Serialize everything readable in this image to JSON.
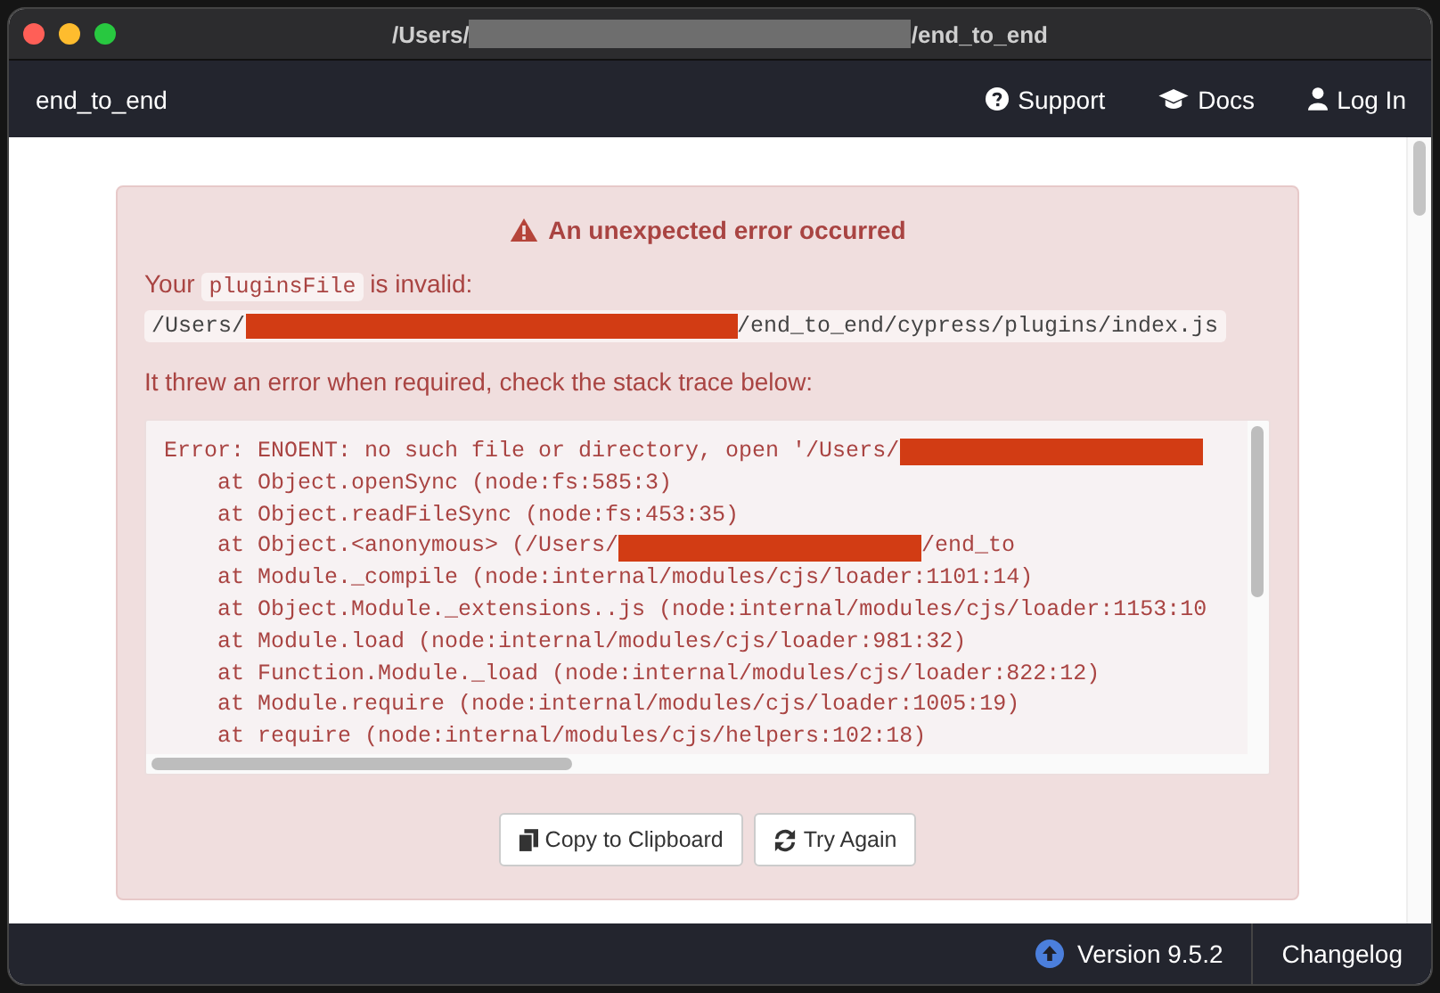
{
  "window": {
    "title_before": "/Users/",
    "title_after": "/end_to_end"
  },
  "navbar": {
    "project": "end_to_end",
    "links": [
      {
        "kind": "support",
        "label": "Support"
      },
      {
        "kind": "docs",
        "label": "Docs"
      },
      {
        "kind": "login",
        "label": "Log In"
      }
    ]
  },
  "error": {
    "heading": "An unexpected error occurred",
    "intro_before": "Your",
    "intro_code": "pluginsFile",
    "intro_after": "is invalid:",
    "path": {
      "text": "/Users/",
      "redacted": true,
      "after": "/end_to_end/cypress/plugins/index.js"
    },
    "hint": "It threw an error when required, check the stack trace below:",
    "stack": [
      {
        "text": "Error: ENOENT: no such file or directory, open '/Users/",
        "redacted": true
      },
      {
        "text": "    at Object.openSync (node:fs:585:3)",
        "redacted": false
      },
      {
        "text": "    at Object.readFileSync (node:fs:453:35)",
        "redacted": false
      },
      {
        "text": "    at Object.<anonymous> (/Users/",
        "redacted": true,
        "after": "/end_to"
      },
      {
        "text": "    at Module._compile (node:internal/modules/cjs/loader:1101:14)",
        "redacted": false
      },
      {
        "text": "    at Object.Module._extensions..js (node:internal/modules/cjs/loader:1153:10",
        "redacted": false
      },
      {
        "text": "    at Module.load (node:internal/modules/cjs/loader:981:32)",
        "redacted": false
      },
      {
        "text": "    at Function.Module._load (node:internal/modules/cjs/loader:822:12)",
        "redacted": false
      },
      {
        "text": "    at Module.require (node:internal/modules/cjs/loader:1005:19)",
        "redacted": false
      },
      {
        "text": "    at require (node:internal/modules/cjs/helpers:102:18)",
        "redacted": false
      }
    ],
    "buttons": [
      {
        "kind": "copy",
        "label": "Copy to Clipboard"
      },
      {
        "kind": "retry",
        "label": "Try Again"
      }
    ]
  },
  "footer": {
    "version": "Version 9.5.2",
    "changelog": "Changelog"
  }
}
